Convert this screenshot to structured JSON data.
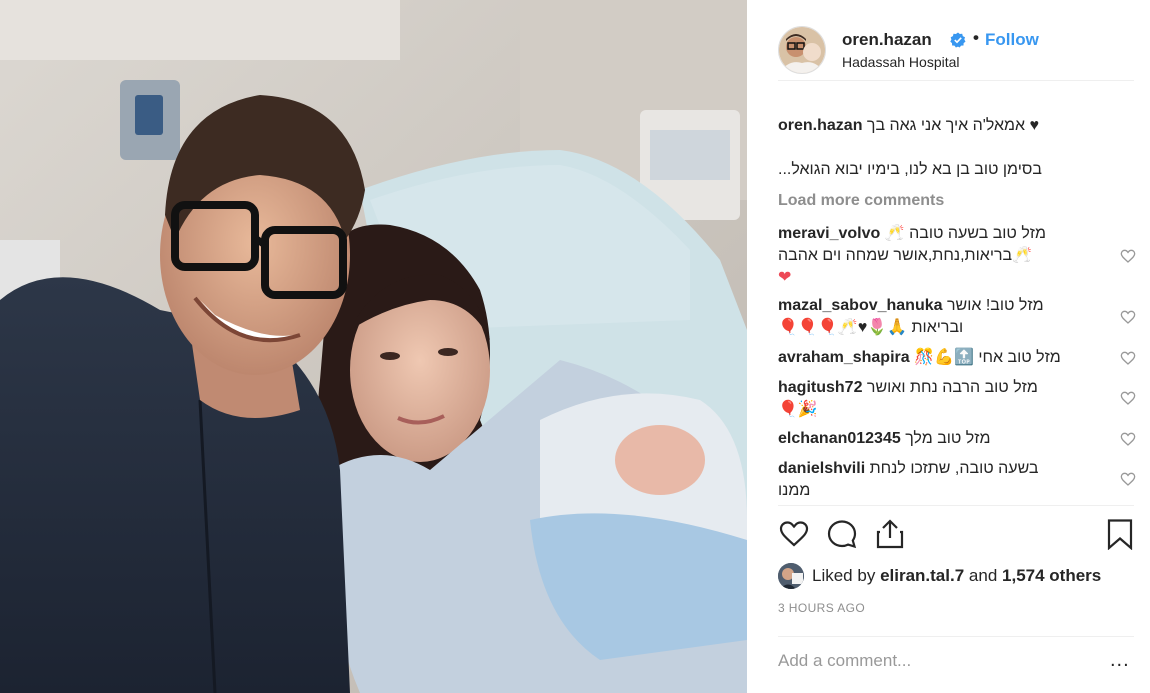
{
  "post": {
    "username": "oren.hazan",
    "follow_label": "Follow",
    "location": "Hadassah Hospital",
    "separator": "•"
  },
  "caption": {
    "username": "oren.hazan",
    "line1": "אמאל'ה איך אני גאה בך",
    "line2": "בסימן טוב בן בא לנו, בימיו יבוא הגואל...",
    "heart": "♥"
  },
  "load_more": "Load more comments",
  "comments": [
    {
      "user": "meravi_volvo",
      "text_line1": "מזל טוב בשעה טובה",
      "text_line2": "בריאות,נחת,אושר שמחה וים אהבה"
    },
    {
      "user": "mazal_sabov_hanuka",
      "text_line1": "מזל טוב! אושר",
      "text_line2": "ובריאות"
    },
    {
      "user": "avraham_shapira",
      "text_line1": "מזל טוב אחי"
    },
    {
      "user": "hagitush72",
      "text_line1": "מזל טוב הרבה נחת ואושר"
    },
    {
      "user": "elchanan012345",
      "text_line1": "מזל טוב מלך"
    },
    {
      "user": "danielshvili",
      "text_line1": "בשעה טובה, שתזכו לנחת",
      "text_line2": "ממנו"
    }
  ],
  "likes": {
    "prefix": "Liked by",
    "user": "eliran.tal.7",
    "middle": "and",
    "count": "1,574 others"
  },
  "timestamp": "3 HOURS AGO",
  "add_comment_placeholder": "Add a comment...",
  "more_options": "...",
  "colors": {
    "link": "#3897f0",
    "verified": "#3897f0",
    "heart": "#ed4956"
  },
  "icons": [
    "heart-icon",
    "comment-icon",
    "share-icon",
    "bookmark-icon",
    "verified-icon"
  ]
}
